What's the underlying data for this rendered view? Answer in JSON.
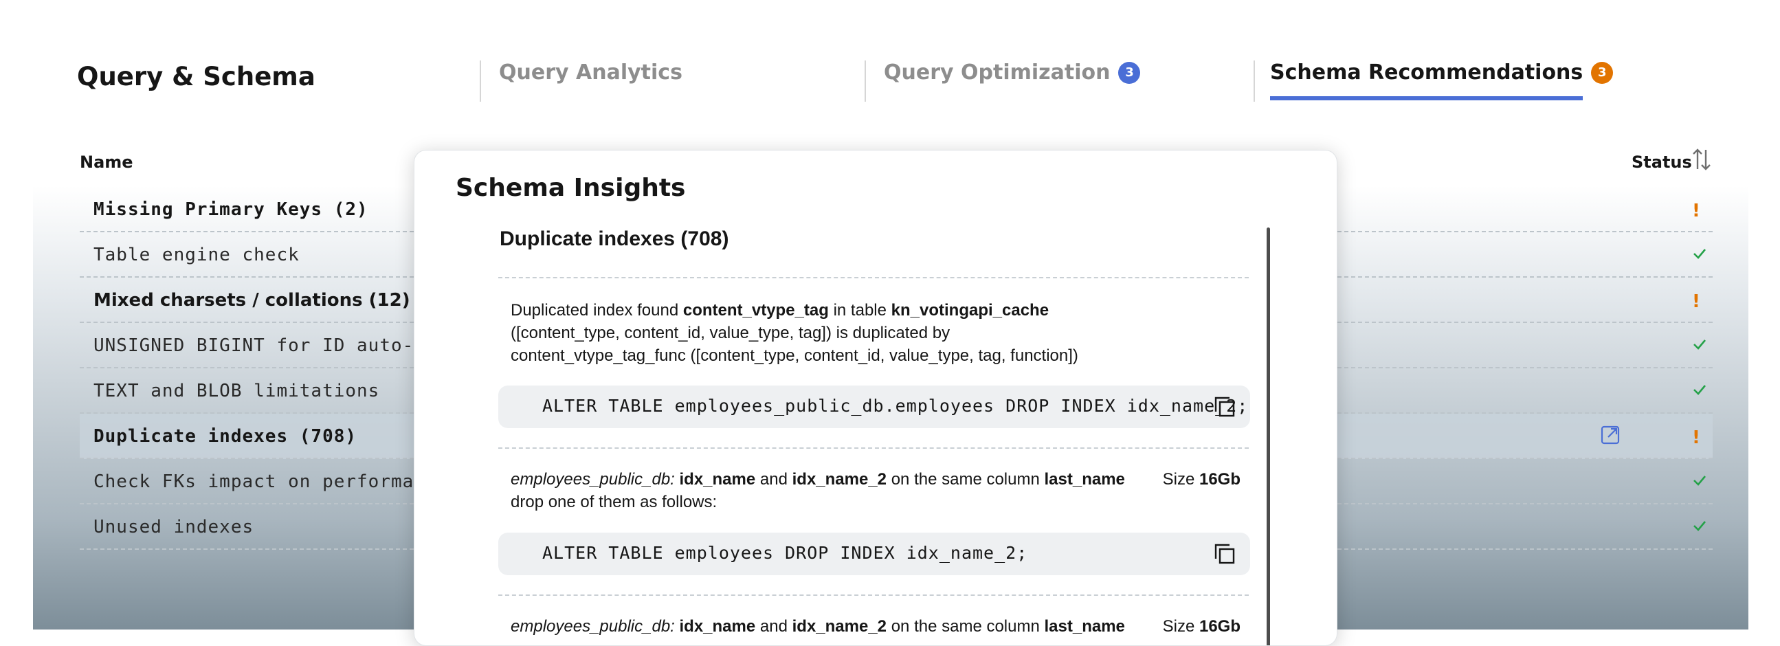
{
  "page": {
    "title": "Query & Schema"
  },
  "tabs": [
    {
      "label": "Query Analytics",
      "badge": "",
      "active": false
    },
    {
      "label": "Query Optimization",
      "badge": "3",
      "badge_color": "#4a6ed6",
      "active": false
    },
    {
      "label": "Schema Recommendations",
      "badge": "3",
      "badge_color": "#e27400",
      "active": true
    }
  ],
  "table": {
    "headers": {
      "name": "Name",
      "status": "Status"
    },
    "rows": [
      {
        "name": "Missing Primary Keys (2)",
        "status": "warning"
      },
      {
        "name": "Table engine check",
        "status": "ok"
      },
      {
        "name": "Mixed charsets / collations (12)",
        "status": "warning"
      },
      {
        "name": "UNSIGNED BIGINT for ID auto-increment",
        "status": "ok"
      },
      {
        "name": "TEXT and BLOB limitations",
        "status": "ok"
      },
      {
        "name": "Duplicate indexes (708)",
        "status": "warning"
      },
      {
        "name": "Check FKs impact on performance",
        "status": "ok"
      },
      {
        "name": "Unused indexes",
        "status": "ok"
      }
    ]
  },
  "modal": {
    "title": "Schema Insights",
    "section_title": "Duplicate indexes (708)",
    "finding1": {
      "prefix": "Duplicated index found",
      "index": "content_vtype_tag",
      "mid": "in table",
      "table": "kn_votingapi_cache",
      "line2": "([content_type, content_id, value_type, tag]) is duplicated by",
      "line3": "content_vtype_tag_func ([content_type, content_id, value_type, tag, function])",
      "code": "ALTER TABLE employees_public_db.employees DROP INDEX idx_name_2;"
    },
    "finding2": {
      "db": "employees_public_db:",
      "idx1": "idx_name",
      "and": "and",
      "idx2": "idx_name_2",
      "mid": "on the same column",
      "column": "last_name",
      "line2": "drop one of them as follows:",
      "size_label": "Size",
      "size_value": "16Gb",
      "code": "ALTER TABLE employees DROP INDEX idx_name_2;"
    },
    "finding3": {
      "db": "employees_public_db:",
      "idx1": "idx_name",
      "and": "and",
      "idx2": "idx_name_2",
      "mid": "on the same column",
      "column": "last_name",
      "size_label": "Size",
      "size_value": "16Gb"
    }
  },
  "colors": {
    "accent": "#4a6ed6",
    "warning": "#e27400",
    "success": "#24a148"
  }
}
